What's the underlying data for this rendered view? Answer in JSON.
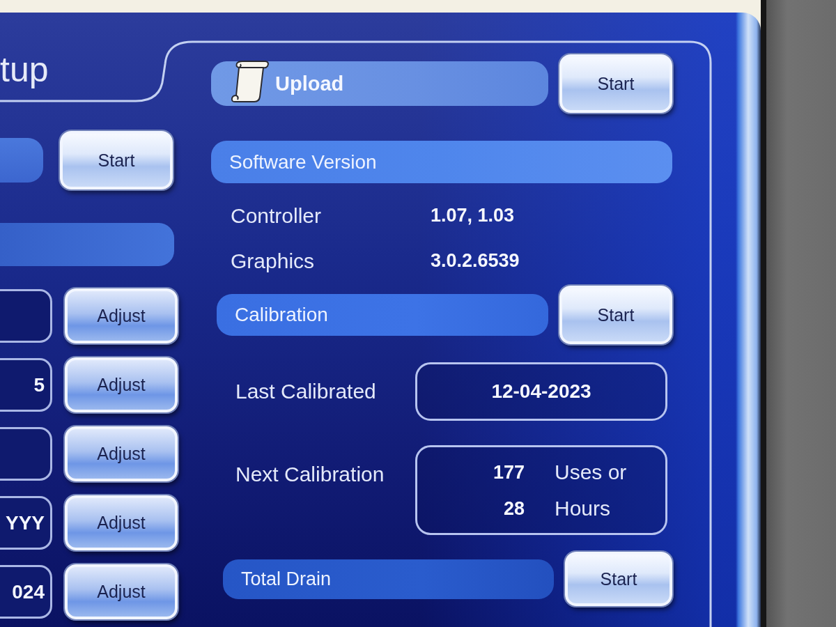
{
  "title": "tup",
  "left_panel": {
    "start_button": "Start",
    "settings": [
      {
        "button": "Adjust"
      },
      {
        "value": "5",
        "button": "Adjust"
      },
      {
        "button": "Adjust"
      },
      {
        "value": "YYY",
        "button": "Adjust"
      },
      {
        "value": "024",
        "button": "Adjust"
      }
    ]
  },
  "upload": {
    "label": "Upload",
    "button": "Start"
  },
  "software_version": {
    "heading": "Software Version",
    "items": [
      {
        "label": "Controller",
        "value": "1.07, 1.03"
      },
      {
        "label": "Graphics",
        "value": "3.0.2.6539"
      }
    ]
  },
  "calibration": {
    "heading": "Calibration",
    "button": "Start",
    "last_calibrated": {
      "label": "Last Calibrated",
      "value": "12-04-2023"
    },
    "next_calibration": {
      "label": "Next Calibration",
      "lines": [
        {
          "count": "177",
          "unit": "Uses or"
        },
        {
          "count": "28",
          "unit": "Hours"
        }
      ]
    }
  },
  "total_drain": {
    "heading": "Total Drain",
    "button": "Start"
  }
}
